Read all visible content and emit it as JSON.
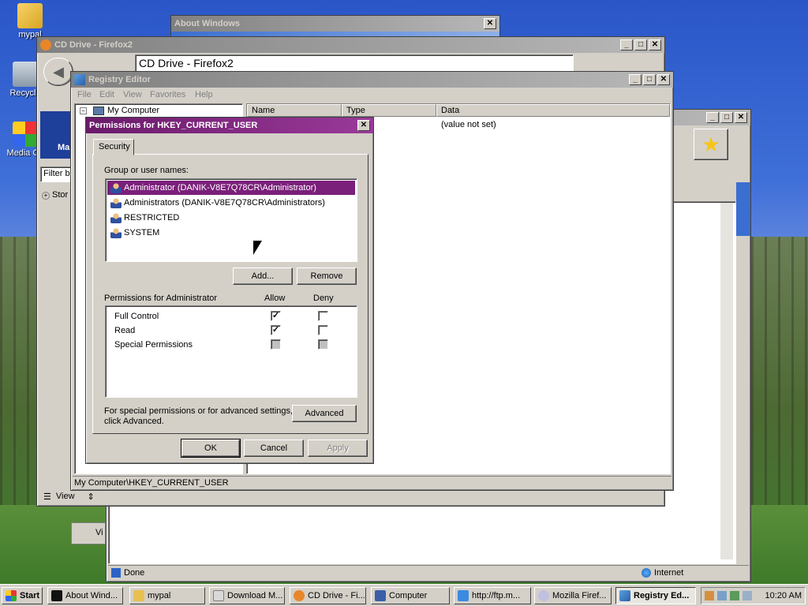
{
  "desktop": {
    "icons": [
      {
        "label": "mypal"
      },
      {
        "label": "Recycle"
      },
      {
        "label": "Media Ce"
      }
    ]
  },
  "about_window": {
    "title": "About Windows"
  },
  "firefox_window": {
    "title": "CD Drive - Firefox2",
    "address": "CD Drive - Firefox2",
    "filter": "Filter b",
    "side_item": "Stor",
    "view_label": "View",
    "left_tab": "Ma"
  },
  "ie_window": {
    "status": "Done",
    "zone": "Internet"
  },
  "regedit": {
    "title": "Registry Editor",
    "menu": [
      "File",
      "Edit",
      "View",
      "Favorites",
      "Help"
    ],
    "tree_root": "My Computer",
    "columns": [
      "Name",
      "Type",
      "Data"
    ],
    "row_data": "(value not set)",
    "statusbar": "My Computer\\HKEY_CURRENT_USER",
    "bottom_view": "Vi"
  },
  "permissions": {
    "title": "Permissions for HKEY_CURRENT_USER",
    "tab": "Security",
    "group_label": "Group or user names:",
    "users": [
      "Administrator (DANIK-V8E7Q78CR\\Administrator)",
      "Administrators (DANIK-V8E7Q78CR\\Administrators)",
      "RESTRICTED",
      "SYSTEM"
    ],
    "selected_user_index": 0,
    "add_label": "Add...",
    "remove_label": "Remove",
    "perm_label": "Permissions for Administrator",
    "allow_label": "Allow",
    "deny_label": "Deny",
    "perms": [
      {
        "name": "Full Control",
        "allow": "checked",
        "deny": "unchecked"
      },
      {
        "name": "Read",
        "allow": "checked",
        "deny": "unchecked"
      },
      {
        "name": "Special Permissions",
        "allow": "grayed",
        "deny": "grayed"
      }
    ],
    "advanced_text_1": "For special permissions or for advanced settings,",
    "advanced_text_2": "click Advanced.",
    "advanced_label": "Advanced",
    "ok_label": "OK",
    "cancel_label": "Cancel",
    "apply_label": "Apply"
  },
  "taskbar": {
    "start": "Start",
    "tasks": [
      "About Wind...",
      "mypal",
      "Download M...",
      "CD Drive - Fi...",
      "Computer",
      "http://ftp.m...",
      "Mozilla Firef...",
      "Registry Ed..."
    ],
    "active_task_index": 7,
    "clock": "10:20 AM"
  },
  "colors": {
    "active_title": "#6a1a6a",
    "selection": "#7a1f7a",
    "face": "#d4d0c8"
  }
}
